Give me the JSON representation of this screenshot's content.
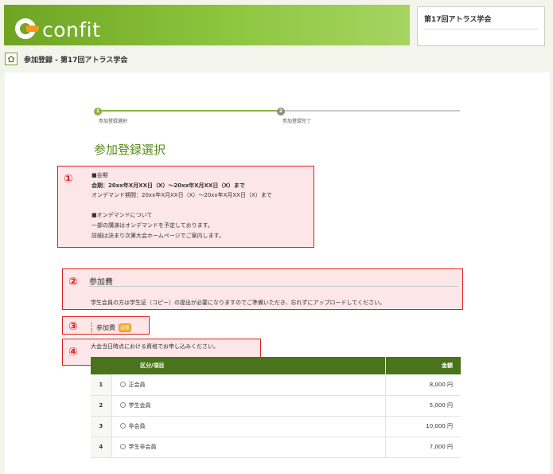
{
  "header": {
    "logo_text": "confit",
    "conference_name": "第17回アトラス学会"
  },
  "breadcrumb": {
    "text": "参加登録 - 第17回アトラス学会"
  },
  "stepper": {
    "steps": [
      {
        "num": "1",
        "label": "参加登録選択",
        "active": true
      },
      {
        "num": "2",
        "label": "参加登録完了",
        "active": false
      }
    ]
  },
  "page_title": "参加登録選択",
  "annotations": [
    "①",
    "②",
    "③",
    "④"
  ],
  "period": {
    "heading": "■会期",
    "line1": "会期：20xx年X月XX日（X）～20xx年X月XX日（X）まで",
    "line2": "オンデマンド期間：20xx年X月XX日（X）～20xx年X月XX日（X）まで",
    "ondemand_heading": "■オンデマンドについて",
    "ondemand_line1": "一部の講演はオンデマンドを予定しております。",
    "ondemand_line2": "詳細は決まり次第大会ホームページでご案内します。"
  },
  "fee_section": {
    "heading": "参加費",
    "description": "学生会員の方は学生証（コピー）の提出が必要になりますのでご準備いただき、忘れずにアップロードしてください。",
    "field_label": "参加費",
    "required_badge": "必須",
    "apply_note": "大会当日時点における資格でお申し込みください。"
  },
  "fee_table": {
    "headers": {
      "no": "",
      "item": "区分/項目",
      "amount": "金額"
    },
    "rows": [
      {
        "no": "1",
        "item": "正会員",
        "amount": "8,000 円"
      },
      {
        "no": "2",
        "item": "学生会員",
        "amount": "5,000 円"
      },
      {
        "no": "3",
        "item": "非会員",
        "amount": "10,000 円"
      },
      {
        "no": "4",
        "item": "学生非会員",
        "amount": "7,000 円"
      }
    ]
  },
  "colors": {
    "brand_green": "#8cc63f",
    "dark_green": "#4a741b",
    "annotation_red": "#e02020",
    "annotation_fill": "#fde6e8",
    "badge_orange": "#f3b33d"
  },
  "icons": {
    "home": "home-icon",
    "logo": "confit-logo-icon",
    "radio": "radio-icon"
  }
}
